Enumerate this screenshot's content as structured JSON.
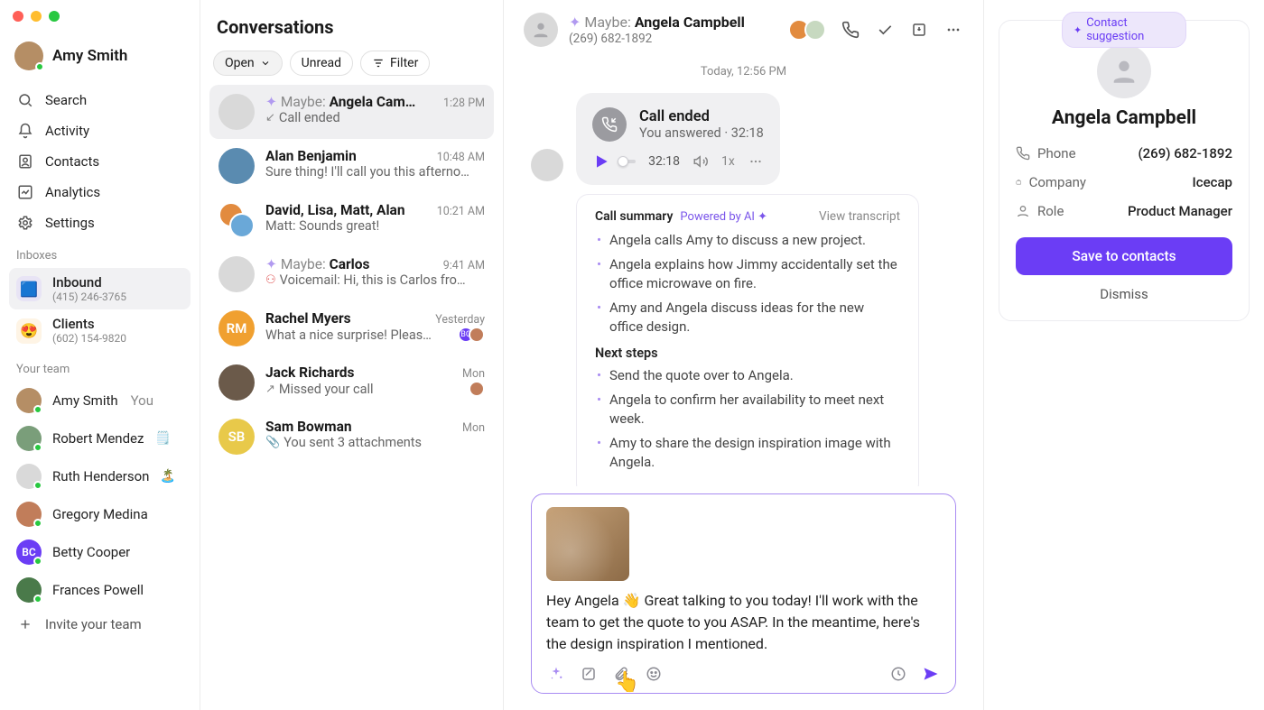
{
  "user": {
    "name": "Amy Smith"
  },
  "nav": {
    "search": "Search",
    "activity": "Activity",
    "contacts": "Contacts",
    "analytics": "Analytics",
    "settings": "Settings"
  },
  "sections": {
    "inboxes": "Inboxes",
    "team": "Your team"
  },
  "inboxes": [
    {
      "label": "Inbound",
      "sub": "(415) 246-3765",
      "icon": "📞"
    },
    {
      "label": "Clients",
      "sub": "(602) 154-9820",
      "icon": "😍"
    }
  ],
  "team": [
    {
      "name": "Amy Smith",
      "you": "You",
      "emoji": ""
    },
    {
      "name": "Robert Mendez",
      "emoji": "🗒️"
    },
    {
      "name": "Ruth Henderson",
      "emoji": "🏝️"
    },
    {
      "name": "Gregory Medina",
      "emoji": ""
    },
    {
      "name": "Betty Cooper",
      "emoji": ""
    },
    {
      "name": "Frances Powell",
      "emoji": ""
    }
  ],
  "invite": "Invite your team",
  "convo_header": "Conversations",
  "filters": {
    "open": "Open",
    "unread": "Unread",
    "filter": "Filter"
  },
  "conversations": [
    {
      "maybe": "Maybe: ",
      "name": "Angela Cam…",
      "time": "1:28 PM",
      "preview": "Call ended",
      "preview_ico": "↙"
    },
    {
      "name": "Alan Benjamin",
      "time": "10:48 AM",
      "preview": "Sure thing! I'll call you this afterno…"
    },
    {
      "name": "David, Lisa, Matt, Alan",
      "time": "10:21 AM",
      "preview": "Matt: Sounds great!"
    },
    {
      "maybe": "Maybe: ",
      "name": "Carlos",
      "time": "9:41 AM",
      "preview": "Voicemail: Hi, this is Carlos fro…",
      "preview_ico": "vm"
    },
    {
      "name": "Rachel Myers",
      "time": "Yesterday",
      "preview": "What a nice surprise! Pleas…",
      "tails": true
    },
    {
      "name": "Jack Richards",
      "time": "Mon",
      "preview": "Missed your call",
      "preview_ico": "↗",
      "tail1": true
    },
    {
      "name": "Sam Bowman",
      "time": "Mon",
      "preview": "You sent 3 attachments",
      "preview_ico": "clip"
    }
  ],
  "chat": {
    "maybe": "Maybe: ",
    "name": "Angela Campbell",
    "phone": "(269) 682-1892",
    "day": "Today, 12:56 PM",
    "call": {
      "title": "Call ended",
      "sub": "You answered · 32:18",
      "dur": "32:18",
      "speed": "1x"
    },
    "summary": {
      "label": "Call summary",
      "ai": "Powered by AI ✦",
      "transcript": "View transcript",
      "bullets": [
        "Angela calls Amy to discuss a new project.",
        "Angela explains how Jimmy accidentally set the office microwave on fire.",
        "Amy and Angela discuss ideas for the new office design."
      ],
      "next_label": "Next steps",
      "next": [
        "Send the quote over to Angela.",
        "Angela to confirm her availability to meet next week.",
        "Amy to share the design inspiration image with Angela."
      ]
    },
    "composer": {
      "text": "Hey Angela 👋 Great talking to you today! I'll work with the team to get the quote to you ASAP. In the meantime, here's the design inspiration I mentioned."
    }
  },
  "contact": {
    "chip": "Contact suggestion",
    "name": "Angela Campbell",
    "phone_label": "Phone",
    "phone": "(269) 682-1892",
    "company_label": "Company",
    "company": "Icecap",
    "role_label": "Role",
    "role": "Product Manager",
    "save": "Save to contacts",
    "dismiss": "Dismiss"
  }
}
